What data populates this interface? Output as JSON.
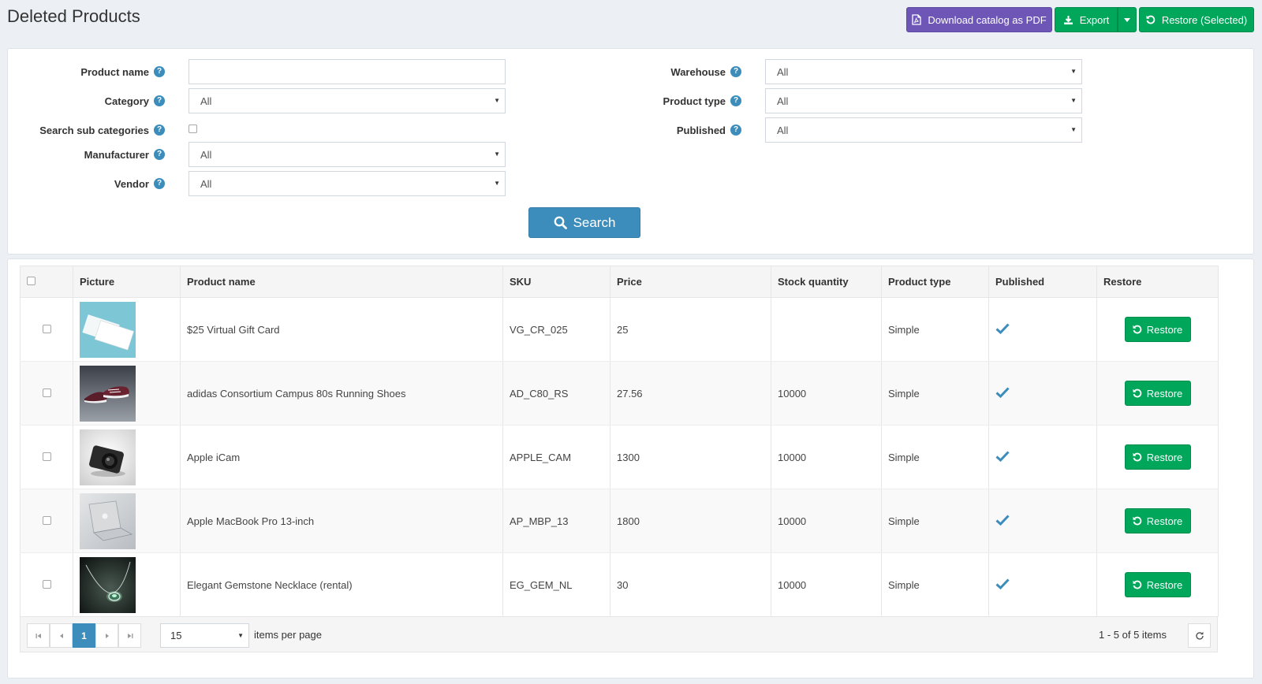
{
  "page": {
    "title": "Deleted Products"
  },
  "actions": {
    "download_pdf": "Download catalog as PDF",
    "export": "Export",
    "restore_selected": "Restore (Selected)"
  },
  "search": {
    "product_name_label": "Product name",
    "product_name_value": "",
    "category_label": "Category",
    "category_value": "All",
    "search_sub_label": "Search sub categories",
    "search_sub_checked": false,
    "manufacturer_label": "Manufacturer",
    "manufacturer_value": "All",
    "vendor_label": "Vendor",
    "vendor_value": "All",
    "warehouse_label": "Warehouse",
    "warehouse_value": "All",
    "product_type_label": "Product type",
    "product_type_value": "All",
    "published_label": "Published",
    "published_value": "All",
    "search_button": "Search",
    "help_glyph": "?"
  },
  "grid": {
    "columns": [
      "Picture",
      "Product name",
      "SKU",
      "Price",
      "Stock quantity",
      "Product type",
      "Published",
      "Restore"
    ],
    "restore_label": "Restore",
    "rows": [
      {
        "name": "$25 Virtual Gift Card",
        "sku": "VG_CR_025",
        "price": "25",
        "stock": "",
        "type": "Simple",
        "published": true,
        "picture": "gift-card"
      },
      {
        "name": "adidas Consortium Campus 80s Running Shoes",
        "sku": "AD_C80_RS",
        "price": "27.56",
        "stock": "10000",
        "type": "Simple",
        "published": true,
        "picture": "shoes"
      },
      {
        "name": "Apple iCam",
        "sku": "APPLE_CAM",
        "price": "1300",
        "stock": "10000",
        "type": "Simple",
        "published": true,
        "picture": "camera"
      },
      {
        "name": "Apple MacBook Pro 13-inch",
        "sku": "AP_MBP_13",
        "price": "1800",
        "stock": "10000",
        "type": "Simple",
        "published": true,
        "picture": "laptop"
      },
      {
        "name": "Elegant Gemstone Necklace (rental)",
        "sku": "EG_GEM_NL",
        "price": "30",
        "stock": "10000",
        "type": "Simple",
        "published": true,
        "picture": "necklace"
      }
    ]
  },
  "pager": {
    "current_page": "1",
    "page_size": "15",
    "items_per_page": "items per page",
    "info": "1 - 5 of 5 items"
  },
  "colors": {
    "primary": "#3c8dbc",
    "success": "#00a65a",
    "purple": "#6d56b5",
    "background": "#ecf0f5"
  }
}
